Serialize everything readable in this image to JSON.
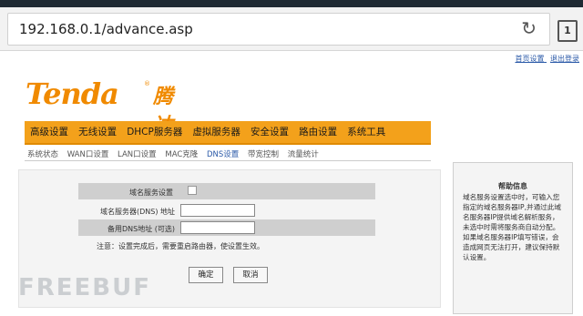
{
  "browser": {
    "url": "192.168.0.1/advance.asp",
    "reload_icon": "reload-icon",
    "tabs_count": "1"
  },
  "top_links": {
    "home": "首页设置",
    "logout": "退出登录"
  },
  "logo": {
    "en": "Tenda",
    "reg": "®",
    "cn": "腾达"
  },
  "main_nav": [
    "高级设置",
    "无线设置",
    "DHCP服务器",
    "虚拟服务器",
    "安全设置",
    "路由设置",
    "系统工具"
  ],
  "sub_nav": [
    "系统状态",
    "WAN口设置",
    "LAN口设置",
    "MAC克隆",
    "DNS设置",
    "带宽控制",
    "流量统计"
  ],
  "sub_nav_active": "DNS设置",
  "form": {
    "dns_enable_label": "域名服务设置",
    "primary_dns_label": "域名服务器(DNS) 地址",
    "primary_dns_value": "",
    "secondary_dns_label": "备用DNS地址 (可选)",
    "secondary_dns_value": "",
    "note": "注意：设置完成后，需要重启路由器，使设置生效。",
    "ok_button": "确定",
    "cancel_button": "取消"
  },
  "help": {
    "title": "帮助信息",
    "body": "域名服务设置选中时，可输入您指定的域名服务器IP,并通过此域名服务器IP提供域名解析服务，未选中时需将服务商自动分配。如果域名服务器IP填写错误，会造成网页无法打开，建议保持默认设置。"
  },
  "watermark": "FREEBUF",
  "colors": {
    "accent": "#f3a11b",
    "brand": "#f08a00",
    "link": "#2b5aa8"
  }
}
